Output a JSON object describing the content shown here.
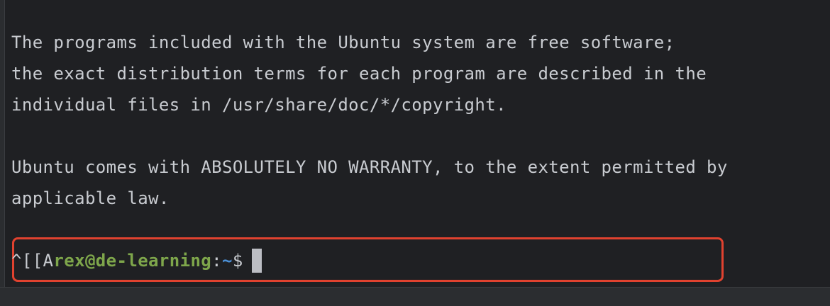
{
  "terminal": {
    "lines": [
      "The programs included with the Ubuntu system are free software;",
      "the exact distribution terms for each program are described in the",
      "individual files in /usr/share/doc/*/copyright.",
      "",
      "Ubuntu comes with ABSOLUTELY NO WARRANTY, to the extent permitted by",
      "applicable law."
    ],
    "prompt": {
      "control_chars": "^[[A",
      "user_host": "rex@de-learning",
      "colon": ":",
      "path": "~",
      "symbol": "$"
    }
  },
  "colors": {
    "background": "#1f2023",
    "text": "#c9ccd1",
    "user_host": "#7ea64b",
    "path": "#4b8fd6",
    "highlight_border": "#e0422f",
    "cursor": "#bcbec4"
  }
}
